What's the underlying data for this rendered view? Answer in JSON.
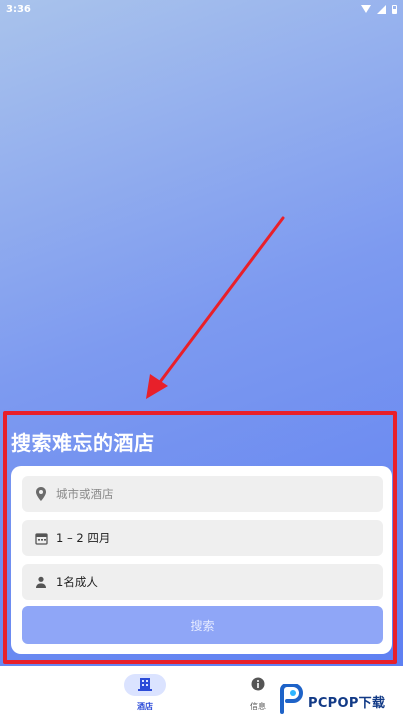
{
  "status_bar": {
    "time": "3:36"
  },
  "search": {
    "title": "搜索难忘的酒店",
    "destination_placeholder": "城市或酒店",
    "dates": "1 – 2 四月",
    "guests": "1名成人",
    "search_button": "搜索"
  },
  "bottom_nav": {
    "items": [
      {
        "label": "酒店",
        "icon": "hotel-icon",
        "active": true
      },
      {
        "label": "信息",
        "icon": "info-icon",
        "active": false
      }
    ]
  },
  "watermark": {
    "text": "PCPOP下载",
    "icon": "pcpop-logo"
  },
  "colors": {
    "accent": "#2b4bd8",
    "highlight_border": "#e8202a",
    "button_disabled": "#8fa6f7",
    "arrow": "#e8202a"
  }
}
